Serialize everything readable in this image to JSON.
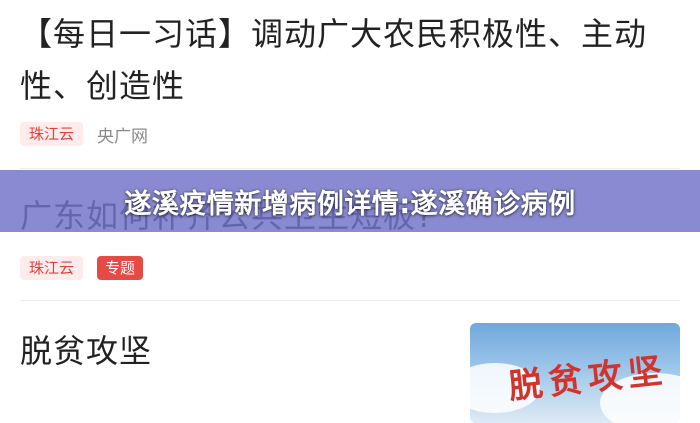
{
  "feed": {
    "articles": [
      {
        "title": "【每日一习话】调动广大农民积极性、主动性、创造性",
        "channel_tag": "珠江云",
        "source": "央广网"
      },
      {
        "title": "广东如何补齐公共卫生短板?",
        "channel_tag": "珠江云",
        "topic_tag": "专题"
      },
      {
        "title": "脱贫攻坚",
        "thumbnail_text": "脱贫攻坚"
      }
    ]
  },
  "overlay": {
    "title": "遂溪疫情新增病例详情:遂溪确诊病例"
  },
  "colors": {
    "tag_red": "#e0413a",
    "tag_bg": "#fdeceb",
    "overlay": "#7070c8"
  }
}
